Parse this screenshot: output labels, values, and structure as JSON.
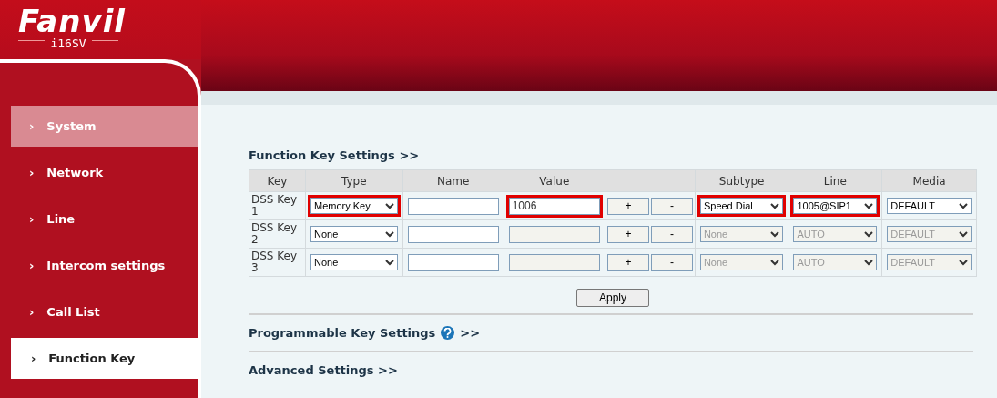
{
  "brand": {
    "logo": "Fanvil",
    "model": "i16SV"
  },
  "sidebar": {
    "items": [
      {
        "label": "System",
        "selected": false,
        "hovered": true
      },
      {
        "label": "Network",
        "selected": false,
        "hovered": false
      },
      {
        "label": "Line",
        "selected": false,
        "hovered": false
      },
      {
        "label": "Intercom settings",
        "selected": false,
        "hovered": false
      },
      {
        "label": "Call List",
        "selected": false,
        "hovered": false
      },
      {
        "label": "Function Key",
        "selected": true,
        "hovered": false
      }
    ]
  },
  "arrow": "›",
  "section_title": "Function Key Settings >>",
  "table": {
    "columns": [
      "Key",
      "Type",
      "Name",
      "Value",
      "",
      "Subtype",
      "Line",
      "Media"
    ],
    "rows": [
      {
        "key": "DSS Key 1",
        "type": {
          "value": "Memory Key",
          "highlighted": true
        },
        "name": {
          "highlighted": false
        },
        "value": {
          "value": "1006",
          "disabled": false,
          "highlighted": true
        },
        "buttons": [
          "+",
          "-"
        ],
        "subtype": {
          "value": "Speed Dial",
          "disabled": false,
          "highlighted": true
        },
        "line": {
          "value": "1005@SIP1",
          "disabled": false,
          "highlighted": true
        },
        "media": {
          "value": "DEFAULT",
          "disabled": false,
          "highlighted": false
        }
      },
      {
        "key": "DSS Key 2",
        "type": {
          "value": "None",
          "highlighted": false
        },
        "name": {
          "highlighted": false
        },
        "value": {
          "disabled": true,
          "highlighted": false
        },
        "buttons": [
          "+",
          "-"
        ],
        "subtype": {
          "value": "None",
          "disabled": true,
          "highlighted": false
        },
        "line": {
          "value": "AUTO",
          "disabled": true,
          "highlighted": false
        },
        "media": {
          "value": "DEFAULT",
          "disabled": true,
          "highlighted": false
        }
      },
      {
        "key": "DSS Key 3",
        "type": {
          "value": "None",
          "highlighted": false
        },
        "name": {
          "highlighted": false
        },
        "value": {
          "disabled": true,
          "highlighted": false
        },
        "buttons": [
          "+",
          "-"
        ],
        "subtype": {
          "value": "None",
          "disabled": true,
          "highlighted": false
        },
        "line": {
          "value": "AUTO",
          "disabled": true,
          "highlighted": false
        },
        "media": {
          "value": "DEFAULT",
          "disabled": true,
          "highlighted": false
        }
      }
    ]
  },
  "apply_button": "Apply",
  "sections": [
    {
      "title": "Programmable Key Settings",
      "help": true,
      "suffix": ">>"
    },
    {
      "title": "Advanced Settings >>",
      "help": false
    }
  ]
}
